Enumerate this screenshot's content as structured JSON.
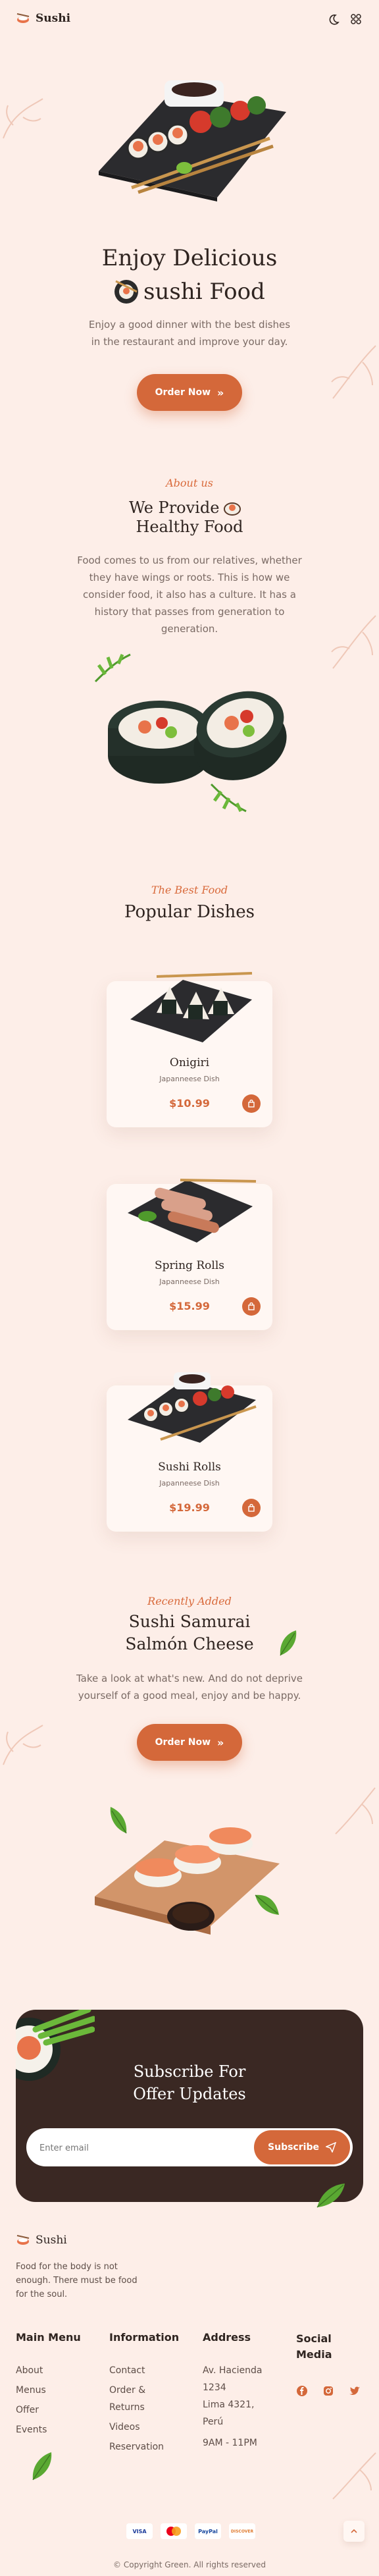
{
  "header": {
    "brand": "Sushi"
  },
  "hero": {
    "title_line1": "Enjoy Delicious",
    "title_line2": "sushi Food",
    "description": "Enjoy a good dinner with the best dishes in the restaurant and improve your day.",
    "order_label": "Order Now"
  },
  "about": {
    "eyebrow": "About us",
    "title_line1": "We Provide",
    "title_line2": "Healthy Food",
    "description": "Food comes to us from our relatives, whether they have wings or roots. This is how we consider food, it also has a culture. It has a history that passes from generation to generation."
  },
  "popular": {
    "eyebrow": "The Best Food",
    "title": "Popular Dishes",
    "dishes": [
      {
        "name": "Onigiri",
        "type": "Japanneese Dish",
        "price": "$10.99"
      },
      {
        "name": "Spring Rolls",
        "type": "Japanneese Dish",
        "price": "$15.99"
      },
      {
        "name": "Sushi Rolls",
        "type": "Japanneese Dish",
        "price": "$19.99"
      }
    ]
  },
  "recent": {
    "eyebrow": "Recently Added",
    "title_line1": "Sushi Samurai",
    "title_line2": "Salmón Cheese",
    "description": "Take a look at what's new. And do not deprive yourself of a good meal, enjoy and be happy.",
    "order_label": "Order Now"
  },
  "subscribe": {
    "title_line1": "Subscribe For",
    "title_line2": "Offer Updates",
    "placeholder": "Enter email",
    "button_label": "Subscribe"
  },
  "footer": {
    "brand": "Sushi",
    "tagline": "Food for the body is not enough. There must be food for the soul.",
    "main_menu": {
      "title": "Main Menu",
      "items": [
        "About",
        "Menus",
        "Offer",
        "Events"
      ]
    },
    "information": {
      "title": "Information",
      "items": [
        "Contact",
        "Order &",
        "Returns",
        "Videos",
        "Reservation"
      ]
    },
    "address": {
      "title": "Address",
      "lines": [
        "Av. Hacienda",
        "1234",
        "Lima 4321,",
        "Perú",
        "9AM - 11PM"
      ]
    },
    "social": {
      "title_line1": "Social",
      "title_line2": "Media",
      "icons": [
        "facebook-icon",
        "instagram-icon",
        "twitter-icon"
      ]
    },
    "payments": [
      "VISA",
      "mastercard",
      "PayPal",
      "DISCOVER"
    ],
    "copyright": "© Copyright Green. All rights reserved"
  },
  "colors": {
    "accent": "#d4683a",
    "background": "#fdeee8",
    "dark": "#3a2823"
  }
}
